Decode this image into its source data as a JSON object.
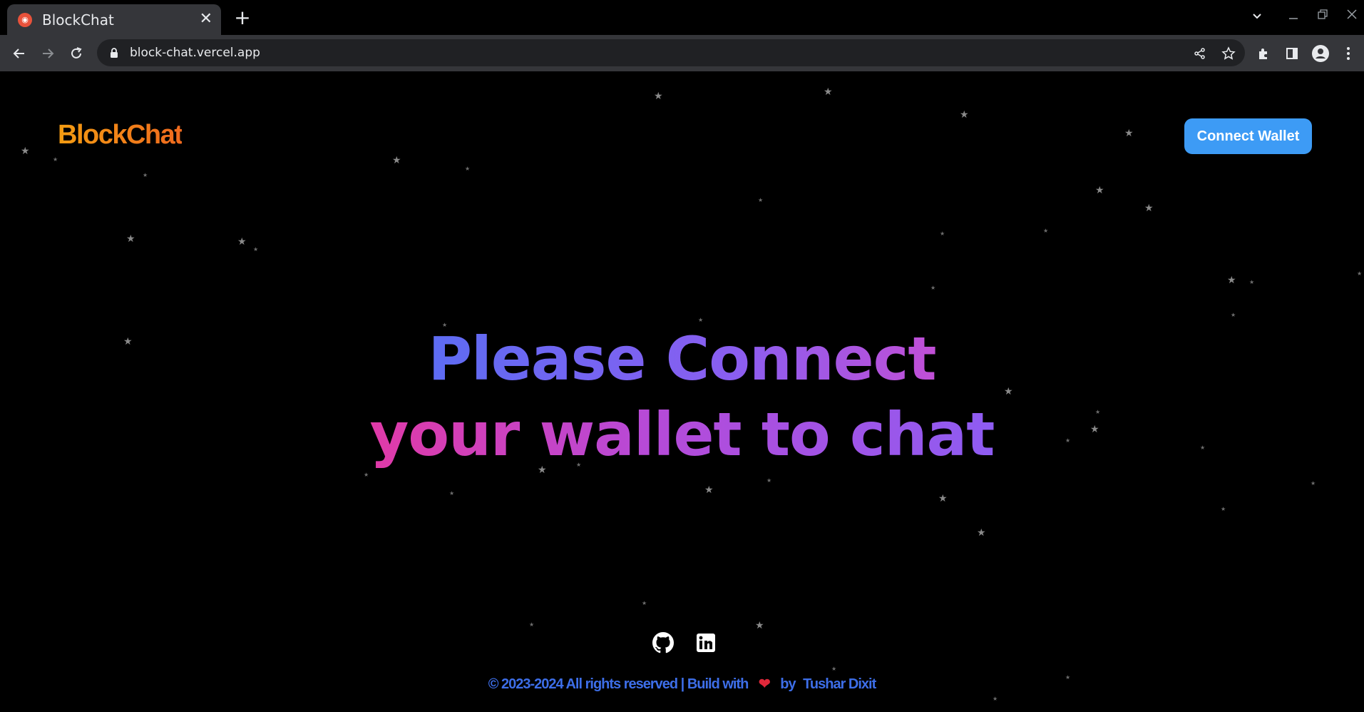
{
  "browser": {
    "tab_title": "BlockChat",
    "url": "block-chat.vercel.app"
  },
  "header": {
    "logo": "BlockChat",
    "connect_button": "Connect Wallet"
  },
  "hero": {
    "line1": "Please Connect",
    "line2": "your wallet to chat"
  },
  "footer": {
    "copyright": "© 2023-2024 All rights reserved | Build with",
    "by": "by",
    "author": "Tushar Dixit",
    "links": [
      "github-icon",
      "linkedin-icon"
    ]
  },
  "colors": {
    "logo": "#f39c12",
    "button": "#3d9bf5",
    "footer_text": "#3d6ee8",
    "heart": "#e0283a"
  }
}
